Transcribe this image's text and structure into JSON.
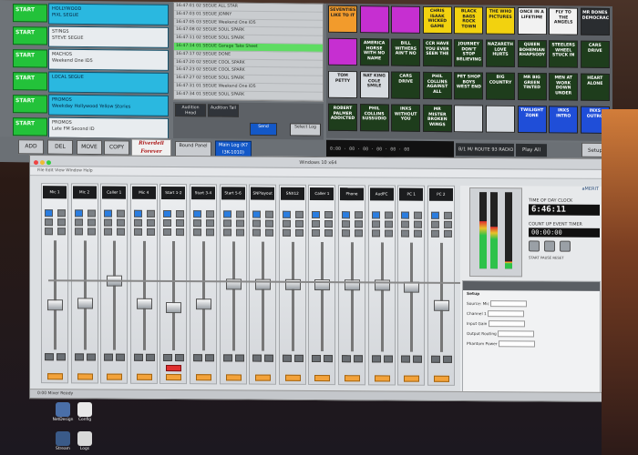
{
  "automation": {
    "start_label": "START",
    "start_items": [
      {
        "line1": "HOLLYWOOD",
        "line2": "PIXL SEGUE",
        "style": "blue"
      },
      {
        "line1": "STINGS",
        "line2": "STEVE SEGUE",
        "style": "white"
      },
      {
        "line1": "MACHOS",
        "line2": "Weekend One ID5",
        "style": "white"
      },
      {
        "line1": "LOCAL SEGUE",
        "line2": "",
        "style": "blue"
      },
      {
        "line1": "PROMOS",
        "line2": "Weekday Hollywood Yellow Stories",
        "style": "blue"
      },
      {
        "line1": "PROMOS",
        "line2": "Late FM Second ID",
        "style": "white"
      }
    ],
    "log_rows": [
      {
        "text": "16:47:01  02  SEGUE  ALL STAR",
        "highlight": false
      },
      {
        "text": "16:47:03  01  SEGUE  JONNY",
        "highlight": false
      },
      {
        "text": "16:47:05  03  SEGUE  Weekend One ID5",
        "highlight": false
      },
      {
        "text": "16:47:08  02  SEGUE  SOUL SPARK",
        "highlight": false
      },
      {
        "text": "16:47:11  02  SEGUE  SOUL SPARK",
        "highlight": false
      },
      {
        "text": "16:47:14  01  SEGUE  Garage Take Sheet",
        "highlight": true
      },
      {
        "text": "16:47:17  02  SEGUE  DONE",
        "highlight": false
      },
      {
        "text": "16:47:20  02  SEGUE  COOL SPARK",
        "highlight": false
      },
      {
        "text": "16:47:23  02  SEGUE  COOL SPARK",
        "highlight": false
      },
      {
        "text": "16:47:27  02  SEGUE  SOUL SPARK",
        "highlight": false
      },
      {
        "text": "16:47:31  01  SEGUE  Weekend One ID5",
        "highlight": false
      },
      {
        "text": "16:47:34  01  SEGUE  SOUL SPARK",
        "highlight": false
      }
    ],
    "mid_controls": [
      "Audition Head",
      "Audition Tail",
      "Send",
      "Select Log"
    ],
    "grid_buttons": [
      {
        "text": "SEVENTIES LIKE TO IT",
        "color": "#f29b2c"
      },
      {
        "text": "",
        "color": "#c62fd1"
      },
      {
        "text": "",
        "color": "#c62fd1"
      },
      {
        "text": "CHRIS ISAAK WICKED GAME",
        "color": "#f2d20f"
      },
      {
        "text": "BLACK BAGS ROCK TOWN",
        "color": "#f2d20f"
      },
      {
        "text": "THE WHO PICTURES",
        "color": "#f2d20f"
      },
      {
        "text": "ONCE IN A LIFETIME",
        "color": "#f2f2f2"
      },
      {
        "text": "FLY TO THE ANGELS",
        "color": "#f2f2f2"
      },
      {
        "text": "MR BONES DEMOCRACY",
        "color": "#2a2d30"
      },
      {
        "text": "",
        "color": "#c62fd1"
      },
      {
        "text": "AMERICA HORSE WITH NO NAME",
        "color": "#1e3d1c"
      },
      {
        "text": "BILL WITHERS AIN'T NO",
        "color": "#1e3d1c"
      },
      {
        "text": "CCR HAVE YOU EVER SEEN THE",
        "color": "#1e3d1c"
      },
      {
        "text": "JOURNEY DON'T STOP BELIEVING",
        "color": "#1e3d1c"
      },
      {
        "text": "NAZARETH LOVE HURTS",
        "color": "#1e3d1c"
      },
      {
        "text": "QUEEN BOHEMIAN RHAPSODY",
        "color": "#1e3d1c"
      },
      {
        "text": "STEELERS WHEEL STUCK IN",
        "color": "#1e3d1c"
      },
      {
        "text": "CARS DRIVE",
        "color": "#1e3d1c"
      },
      {
        "text": "TOM PETTY",
        "color": "#d7dbe0"
      },
      {
        "text": "NAT KING COLE SMILE",
        "color": "#d7dbe0"
      },
      {
        "text": "CARS DRIVE",
        "color": "#1e3d1c"
      },
      {
        "text": "PHIL COLLINS AGAINST ALL",
        "color": "#1e3d1c"
      },
      {
        "text": "PET SHOP BOYS WEST END",
        "color": "#1e3d1c"
      },
      {
        "text": "BIG COUNTRY",
        "color": "#1e3d1c"
      },
      {
        "text": "MR BIG GREEN TINTED",
        "color": "#1e3d1c"
      },
      {
        "text": "MEN AT WORK DOWN UNDER",
        "color": "#1e3d1c"
      },
      {
        "text": "HEART ALONE",
        "color": "#1e3d1c"
      },
      {
        "text": "ROBERT PALMER ADDICTED",
        "color": "#1e3d1c"
      },
      {
        "text": "PHIL COLLINS SUSSUDIO",
        "color": "#1e3d1c"
      },
      {
        "text": "INXS WITHOUT YOU",
        "color": "#1e3d1c"
      },
      {
        "text": "MR MISTER BROKEN WINGS",
        "color": "#1e3d1c"
      },
      {
        "text": "",
        "color": "#d7dbe0"
      },
      {
        "text": "",
        "color": "#d7dbe0"
      },
      {
        "text": "TWILIGHT ZONE",
        "color": "#1f4ed8"
      },
      {
        "text": "INXS INTRO",
        "color": "#1f4ed8"
      },
      {
        "text": "INXS OUTRO",
        "color": "#1f4ed8"
      }
    ],
    "bottom": {
      "add": "ADD",
      "del": "DEL",
      "move": "MOVE",
      "copy": "COPY",
      "logo_line1": "Riverdell",
      "logo_line2": "Forever",
      "bound_panel": "Bound Panel",
      "main_log": "Main Log (K?I3K-1010)",
      "counter": "0:00 · 00 · 00 · 00 · 00 · 00",
      "route": "B/1 M/ ROUTE 93 RADIO",
      "play_all": "Play All",
      "setup": "Setup"
    }
  },
  "mixer": {
    "title": "Windows 10 x64",
    "toolbar": "File  Edit  View  Window  Help",
    "channels": [
      "Mic 1",
      "Mic 2",
      "Caller 1",
      "Mic 4",
      "Start 1-2",
      "Start 3-4",
      "Start 5-6",
      "SNPlayout",
      "SNX12",
      "Caller 1",
      "Phone",
      "AudPC",
      "PC 1",
      "PC 2"
    ],
    "fader_positions": [
      0.4,
      0.42,
      0.65,
      0.42,
      0.38,
      0.42,
      0.62,
      0.62,
      0.62,
      0.62,
      0.62,
      0.62,
      0.6,
      0.42
    ],
    "red_button_channel": 4,
    "clock_brand": "aMERIT",
    "time_of_day_label": "TIME OF DAY CLOCK",
    "time_of_day": "6:46:11",
    "timer_label": "COUNT UP EVENT TIMER",
    "timer_value": "00:00:00",
    "timer_controls": [
      "START",
      "PAUSE",
      "RESET"
    ],
    "setup_title": "Setup",
    "setup_lines": [
      "Source: Mic",
      "Channel 1",
      "Input Gain",
      "Output Routing",
      "Phantom Power"
    ],
    "status": "0:00  Mixer Ready"
  },
  "desktop": {
    "icons": [
      {
        "label": "NetDesign",
        "color": "#4a6fa8"
      },
      {
        "label": "Config",
        "color": "#e8e8e8"
      },
      {
        "label": "Stream",
        "color": "#3a5a88"
      },
      {
        "label": "Logs",
        "color": "#d8d8d8"
      }
    ]
  }
}
